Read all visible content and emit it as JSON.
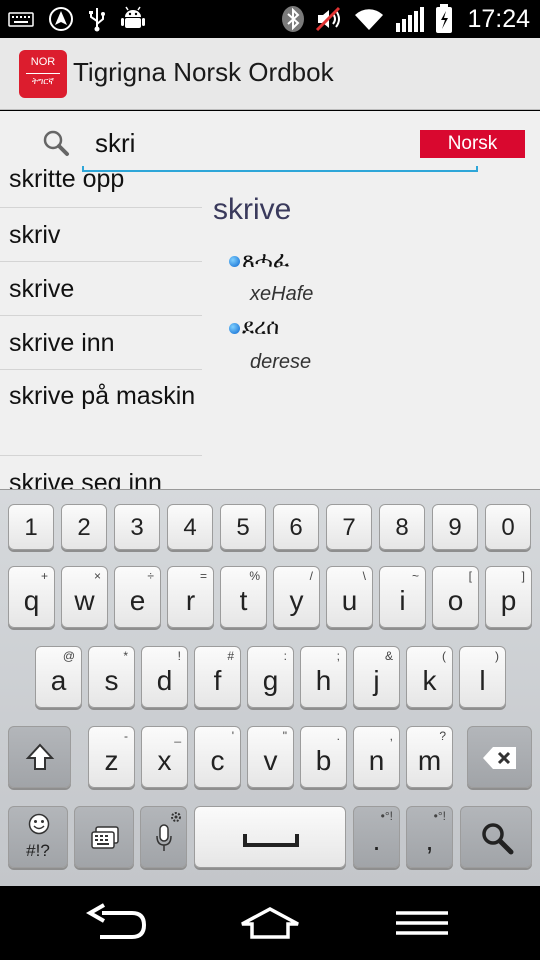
{
  "status_bar": {
    "time": "17:24",
    "icons": [
      "keyboard-icon",
      "navigation-icon",
      "usb-icon",
      "android-debug-icon",
      "bluetooth-icon",
      "mute-icon",
      "wifi-icon",
      "signal-icon",
      "battery-icon"
    ]
  },
  "app_bar": {
    "logo_top": "NOR",
    "logo_bottom": "ትግርኛ",
    "title": "Tigrigna Norsk Ordbok"
  },
  "search": {
    "value": "skri",
    "language_button": "Norsk"
  },
  "word_list": [
    "skritte opp",
    "skriv",
    "skrive",
    "skrive inn",
    "skrive på maskin",
    "skrive seg inn"
  ],
  "entry": {
    "headword": "skrive",
    "translations": [
      {
        "tigrigna": "ጸሓፈ",
        "romanized": "xeHafe"
      },
      {
        "tigrigna": "ደረሰ",
        "romanized": "derese"
      }
    ]
  },
  "keyboard": {
    "number_row": [
      "1",
      "2",
      "3",
      "4",
      "5",
      "6",
      "7",
      "8",
      "9",
      "0"
    ],
    "row1": [
      {
        "key": "q",
        "sub": "+"
      },
      {
        "key": "w",
        "sub": "×"
      },
      {
        "key": "e",
        "sub": "÷"
      },
      {
        "key": "r",
        "sub": "="
      },
      {
        "key": "t",
        "sub": "%"
      },
      {
        "key": "y",
        "sub": "/"
      },
      {
        "key": "u",
        "sub": "\\"
      },
      {
        "key": "i",
        "sub": "~"
      },
      {
        "key": "o",
        "sub": "["
      },
      {
        "key": "p",
        "sub": "]"
      }
    ],
    "row2": [
      {
        "key": "a",
        "sub": "@"
      },
      {
        "key": "s",
        "sub": "*"
      },
      {
        "key": "d",
        "sub": "!"
      },
      {
        "key": "f",
        "sub": "#"
      },
      {
        "key": "g",
        "sub": ":"
      },
      {
        "key": "h",
        "sub": ";"
      },
      {
        "key": "j",
        "sub": "&"
      },
      {
        "key": "k",
        "sub": "("
      },
      {
        "key": "l",
        "sub": ")"
      }
    ],
    "row3": [
      {
        "key": "z",
        "sub": "-"
      },
      {
        "key": "x",
        "sub": "_"
      },
      {
        "key": "c",
        "sub": "'"
      },
      {
        "key": "v",
        "sub": "\""
      },
      {
        "key": "b",
        "sub": "."
      },
      {
        "key": "n",
        "sub": ","
      },
      {
        "key": "m",
        "sub": "?"
      }
    ],
    "emoji_label": "#!?",
    "period_key": ".",
    "period_sub": "•°!",
    "comma_key": ",",
    "comma_sub": "•°!"
  }
}
